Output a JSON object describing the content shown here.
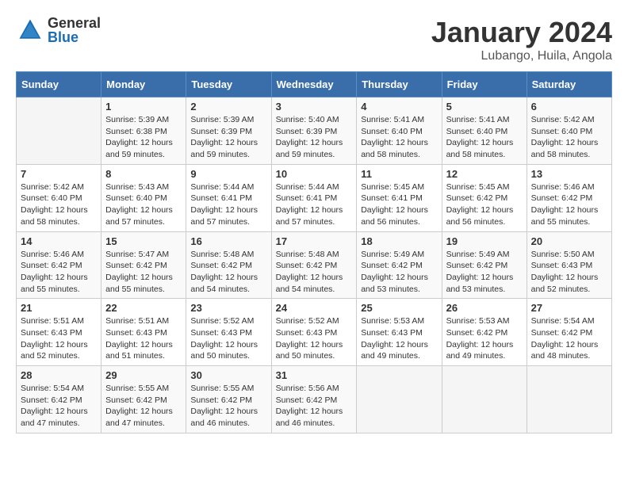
{
  "header": {
    "logo_general": "General",
    "logo_blue": "Blue",
    "title": "January 2024",
    "subtitle": "Lubango, Huila, Angola"
  },
  "columns": [
    "Sunday",
    "Monday",
    "Tuesday",
    "Wednesday",
    "Thursday",
    "Friday",
    "Saturday"
  ],
  "weeks": [
    [
      {
        "day": "",
        "sunrise": "",
        "sunset": "",
        "daylight": ""
      },
      {
        "day": "1",
        "sunrise": "Sunrise: 5:39 AM",
        "sunset": "Sunset: 6:38 PM",
        "daylight": "Daylight: 12 hours and 59 minutes."
      },
      {
        "day": "2",
        "sunrise": "Sunrise: 5:39 AM",
        "sunset": "Sunset: 6:39 PM",
        "daylight": "Daylight: 12 hours and 59 minutes."
      },
      {
        "day": "3",
        "sunrise": "Sunrise: 5:40 AM",
        "sunset": "Sunset: 6:39 PM",
        "daylight": "Daylight: 12 hours and 59 minutes."
      },
      {
        "day": "4",
        "sunrise": "Sunrise: 5:41 AM",
        "sunset": "Sunset: 6:40 PM",
        "daylight": "Daylight: 12 hours and 58 minutes."
      },
      {
        "day": "5",
        "sunrise": "Sunrise: 5:41 AM",
        "sunset": "Sunset: 6:40 PM",
        "daylight": "Daylight: 12 hours and 58 minutes."
      },
      {
        "day": "6",
        "sunrise": "Sunrise: 5:42 AM",
        "sunset": "Sunset: 6:40 PM",
        "daylight": "Daylight: 12 hours and 58 minutes."
      }
    ],
    [
      {
        "day": "7",
        "sunrise": "Sunrise: 5:42 AM",
        "sunset": "Sunset: 6:40 PM",
        "daylight": "Daylight: 12 hours and 58 minutes."
      },
      {
        "day": "8",
        "sunrise": "Sunrise: 5:43 AM",
        "sunset": "Sunset: 6:40 PM",
        "daylight": "Daylight: 12 hours and 57 minutes."
      },
      {
        "day": "9",
        "sunrise": "Sunrise: 5:44 AM",
        "sunset": "Sunset: 6:41 PM",
        "daylight": "Daylight: 12 hours and 57 minutes."
      },
      {
        "day": "10",
        "sunrise": "Sunrise: 5:44 AM",
        "sunset": "Sunset: 6:41 PM",
        "daylight": "Daylight: 12 hours and 57 minutes."
      },
      {
        "day": "11",
        "sunrise": "Sunrise: 5:45 AM",
        "sunset": "Sunset: 6:41 PM",
        "daylight": "Daylight: 12 hours and 56 minutes."
      },
      {
        "day": "12",
        "sunrise": "Sunrise: 5:45 AM",
        "sunset": "Sunset: 6:42 PM",
        "daylight": "Daylight: 12 hours and 56 minutes."
      },
      {
        "day": "13",
        "sunrise": "Sunrise: 5:46 AM",
        "sunset": "Sunset: 6:42 PM",
        "daylight": "Daylight: 12 hours and 55 minutes."
      }
    ],
    [
      {
        "day": "14",
        "sunrise": "Sunrise: 5:46 AM",
        "sunset": "Sunset: 6:42 PM",
        "daylight": "Daylight: 12 hours and 55 minutes."
      },
      {
        "day": "15",
        "sunrise": "Sunrise: 5:47 AM",
        "sunset": "Sunset: 6:42 PM",
        "daylight": "Daylight: 12 hours and 55 minutes."
      },
      {
        "day": "16",
        "sunrise": "Sunrise: 5:48 AM",
        "sunset": "Sunset: 6:42 PM",
        "daylight": "Daylight: 12 hours and 54 minutes."
      },
      {
        "day": "17",
        "sunrise": "Sunrise: 5:48 AM",
        "sunset": "Sunset: 6:42 PM",
        "daylight": "Daylight: 12 hours and 54 minutes."
      },
      {
        "day": "18",
        "sunrise": "Sunrise: 5:49 AM",
        "sunset": "Sunset: 6:42 PM",
        "daylight": "Daylight: 12 hours and 53 minutes."
      },
      {
        "day": "19",
        "sunrise": "Sunrise: 5:49 AM",
        "sunset": "Sunset: 6:42 PM",
        "daylight": "Daylight: 12 hours and 53 minutes."
      },
      {
        "day": "20",
        "sunrise": "Sunrise: 5:50 AM",
        "sunset": "Sunset: 6:43 PM",
        "daylight": "Daylight: 12 hours and 52 minutes."
      }
    ],
    [
      {
        "day": "21",
        "sunrise": "Sunrise: 5:51 AM",
        "sunset": "Sunset: 6:43 PM",
        "daylight": "Daylight: 12 hours and 52 minutes."
      },
      {
        "day": "22",
        "sunrise": "Sunrise: 5:51 AM",
        "sunset": "Sunset: 6:43 PM",
        "daylight": "Daylight: 12 hours and 51 minutes."
      },
      {
        "day": "23",
        "sunrise": "Sunrise: 5:52 AM",
        "sunset": "Sunset: 6:43 PM",
        "daylight": "Daylight: 12 hours and 50 minutes."
      },
      {
        "day": "24",
        "sunrise": "Sunrise: 5:52 AM",
        "sunset": "Sunset: 6:43 PM",
        "daylight": "Daylight: 12 hours and 50 minutes."
      },
      {
        "day": "25",
        "sunrise": "Sunrise: 5:53 AM",
        "sunset": "Sunset: 6:43 PM",
        "daylight": "Daylight: 12 hours and 49 minutes."
      },
      {
        "day": "26",
        "sunrise": "Sunrise: 5:53 AM",
        "sunset": "Sunset: 6:42 PM",
        "daylight": "Daylight: 12 hours and 49 minutes."
      },
      {
        "day": "27",
        "sunrise": "Sunrise: 5:54 AM",
        "sunset": "Sunset: 6:42 PM",
        "daylight": "Daylight: 12 hours and 48 minutes."
      }
    ],
    [
      {
        "day": "28",
        "sunrise": "Sunrise: 5:54 AM",
        "sunset": "Sunset: 6:42 PM",
        "daylight": "Daylight: 12 hours and 47 minutes."
      },
      {
        "day": "29",
        "sunrise": "Sunrise: 5:55 AM",
        "sunset": "Sunset: 6:42 PM",
        "daylight": "Daylight: 12 hours and 47 minutes."
      },
      {
        "day": "30",
        "sunrise": "Sunrise: 5:55 AM",
        "sunset": "Sunset: 6:42 PM",
        "daylight": "Daylight: 12 hours and 46 minutes."
      },
      {
        "day": "31",
        "sunrise": "Sunrise: 5:56 AM",
        "sunset": "Sunset: 6:42 PM",
        "daylight": "Daylight: 12 hours and 46 minutes."
      },
      {
        "day": "",
        "sunrise": "",
        "sunset": "",
        "daylight": ""
      },
      {
        "day": "",
        "sunrise": "",
        "sunset": "",
        "daylight": ""
      },
      {
        "day": "",
        "sunrise": "",
        "sunset": "",
        "daylight": ""
      }
    ]
  ]
}
